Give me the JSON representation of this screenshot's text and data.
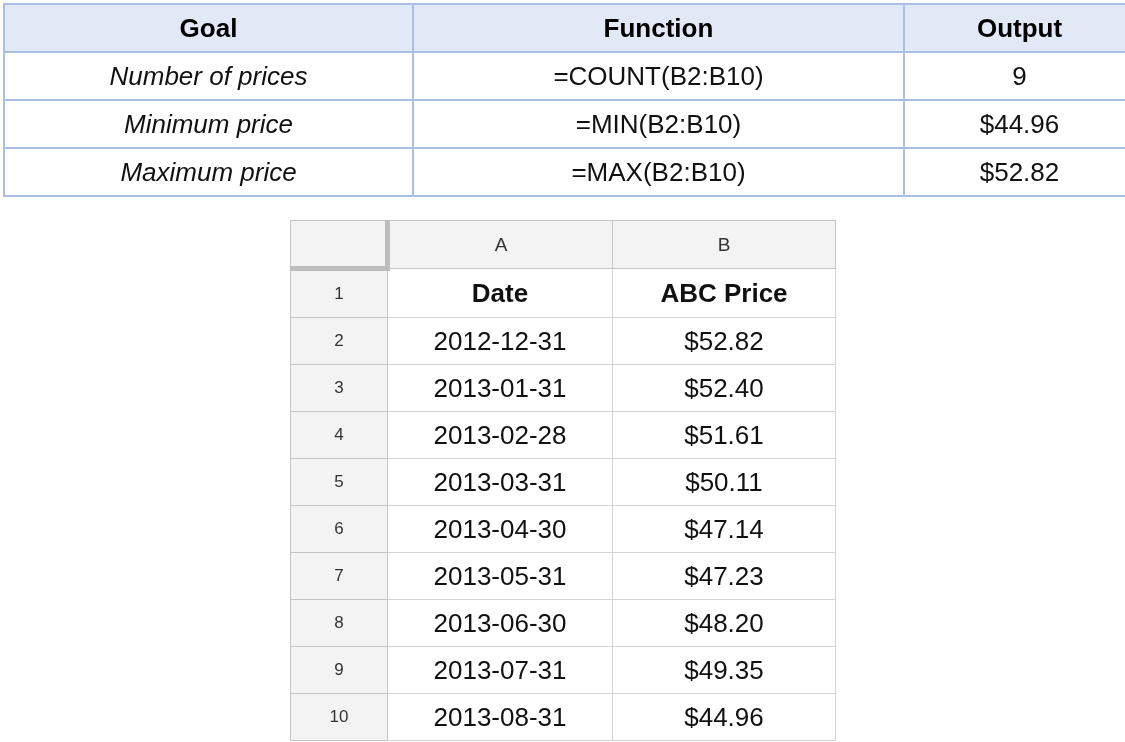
{
  "summary_table": {
    "columns": [
      "Goal",
      "Function",
      "Output"
    ],
    "rows": [
      [
        "Number of prices",
        "=COUNT(B2:B10)",
        "9"
      ],
      [
        "Minimum price",
        "=MIN(B2:B10)",
        "$44.96"
      ],
      [
        "Maximum price",
        "=MAX(B2:B10)",
        "$52.82"
      ]
    ]
  },
  "sheet": {
    "column_headers": [
      "A",
      "B"
    ],
    "rows": [
      {
        "number": "1",
        "kind": "header",
        "cells": [
          "Date",
          "ABC Price"
        ]
      },
      {
        "number": "2",
        "kind": "data",
        "cells": [
          "2012-12-31",
          "$52.82"
        ]
      },
      {
        "number": "3",
        "kind": "data",
        "cells": [
          "2013-01-31",
          "$52.40"
        ]
      },
      {
        "number": "4",
        "kind": "data",
        "cells": [
          "2013-02-28",
          "$51.61"
        ]
      },
      {
        "number": "5",
        "kind": "data",
        "cells": [
          "2013-03-31",
          "$50.11"
        ]
      },
      {
        "number": "6",
        "kind": "data",
        "cells": [
          "2013-04-30",
          "$47.14"
        ]
      },
      {
        "number": "7",
        "kind": "data",
        "cells": [
          "2013-05-31",
          "$47.23"
        ]
      },
      {
        "number": "8",
        "kind": "data",
        "cells": [
          "2013-06-30",
          "$48.20"
        ]
      },
      {
        "number": "9",
        "kind": "data",
        "cells": [
          "2013-07-31",
          "$49.35"
        ]
      },
      {
        "number": "10",
        "kind": "data",
        "cells": [
          "2013-08-31",
          "$44.96"
        ]
      }
    ]
  }
}
